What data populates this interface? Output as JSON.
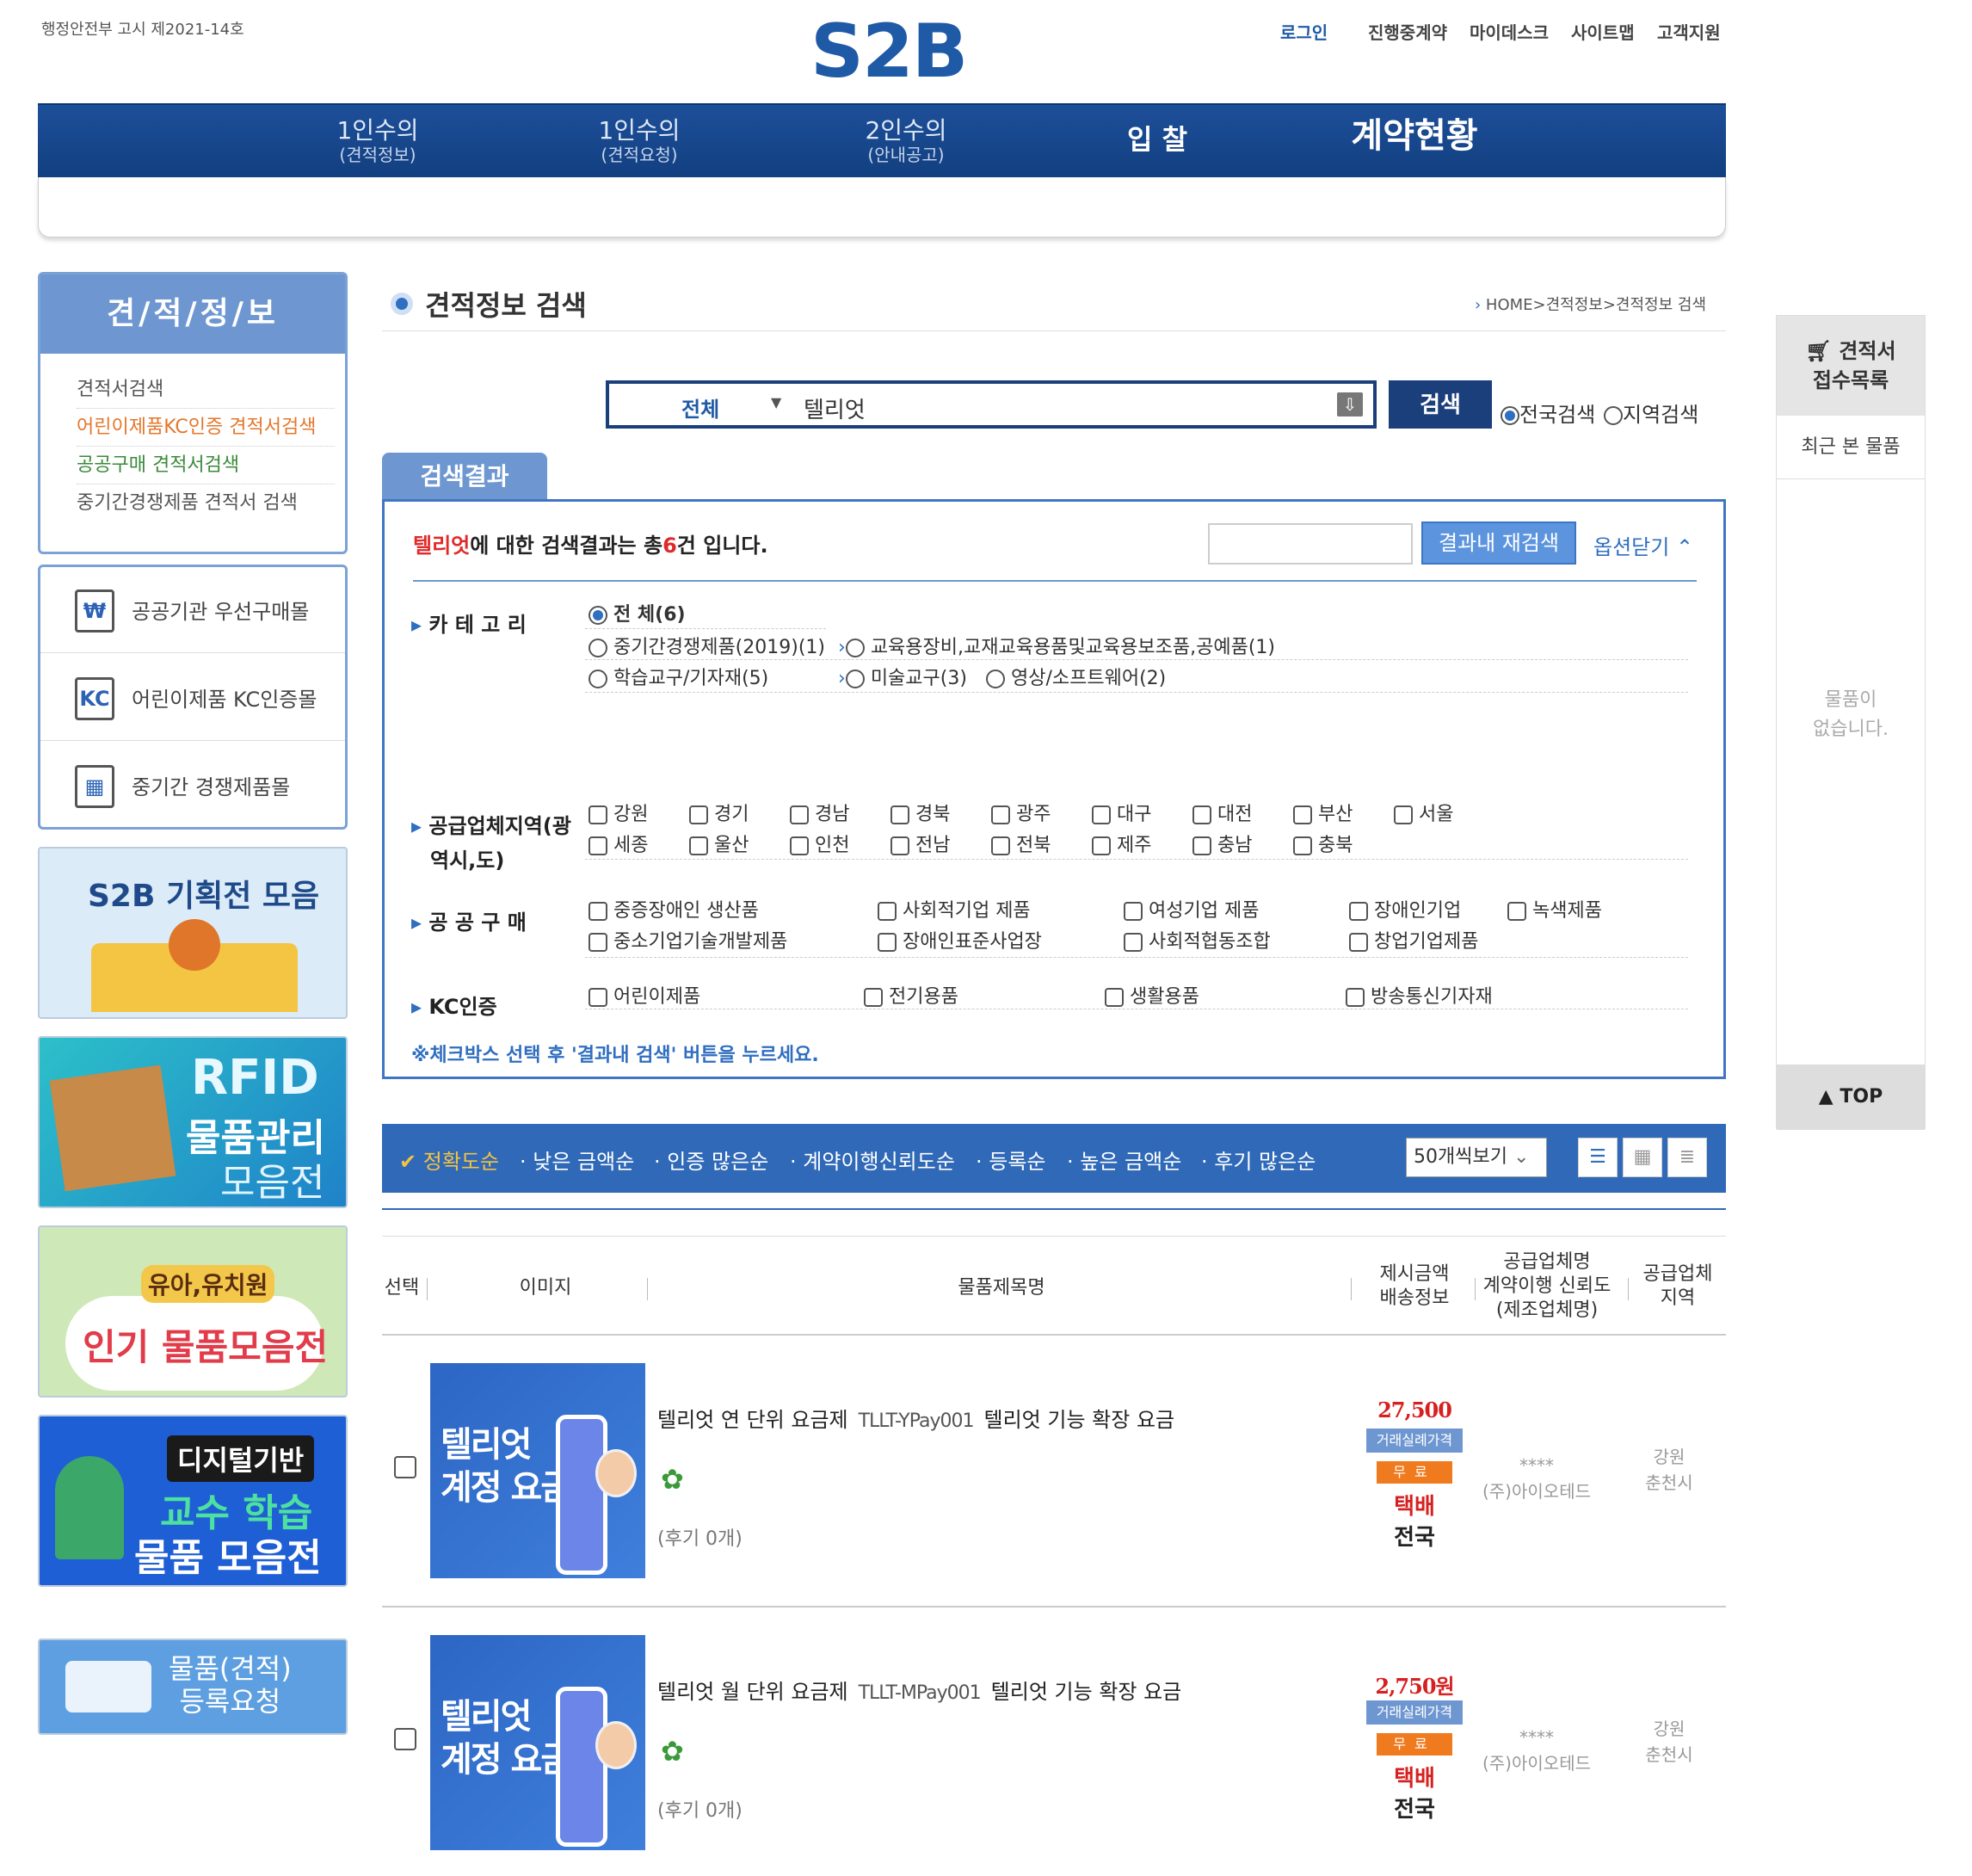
{
  "header": {
    "notice": "행정안전부 고시 제2021-14호",
    "logo": "S2B",
    "top_links": [
      "로그인",
      "진행중계약",
      "마이데스크",
      "사이트맵",
      "고객지원"
    ]
  },
  "gnb": [
    {
      "label": "1인수의",
      "sub": "(견적정보)"
    },
    {
      "label": "1인수의",
      "sub": "(견적요청)"
    },
    {
      "label": "2인수의",
      "sub": "(안내공고)"
    },
    {
      "label": "입 찰"
    },
    {
      "label": "계약현황"
    }
  ],
  "lnb": {
    "title": "견/적/정/보",
    "items": [
      "견적서검색",
      "어린이제품KC인증 견적서검색",
      "공공구매 견적서검색",
      "중기간경쟁제품 견적서 검색"
    ]
  },
  "quick_menu": [
    {
      "icon": "receipt-won-icon",
      "label": "공공기관 우선구매몰"
    },
    {
      "icon": "kc-mark-icon",
      "label": "어린이제품 KC인증몰"
    },
    {
      "icon": "building-icon",
      "label": "중기간 경쟁제품몰"
    }
  ],
  "banners": {
    "b1": "S2B 기획전 모음",
    "b2_line1": "RFID",
    "b2_line2": "물품관리",
    "b2_line3": "모음전",
    "b3_line1": "유아,유치원",
    "b3_line2": "인기 물품모음전",
    "b4_line1": "디지털기반",
    "b4_line2": "교수 학습",
    "b4_line3": "물품 모음전",
    "b5_line1": "물품(견적)",
    "b5_line2": "등록요청"
  },
  "page": {
    "title": "견적정보 검색",
    "breadcrumb": "HOME>견적정보>견적정보 검색"
  },
  "search": {
    "category": "전체",
    "query": "텔리엇",
    "button": "검색",
    "scope_national": "전국검색",
    "scope_region": "지역검색"
  },
  "results": {
    "tab": "검색결과",
    "keyword": "텔리엇",
    "summary_mid": "에 대한 검색결과는 ",
    "summary_total_pre": "총",
    "count": "6",
    "summary_tail": "건 입니다.",
    "refine_button": "결과내 재검색",
    "option_close": "옵션닫기"
  },
  "filters": {
    "category_label": "카 테 고 리",
    "categories": [
      "전 체(6)",
      "중기간경쟁제품(2019)(1)",
      "교육용장비,교재교육용품및교육용보조품,공예품(1)",
      "학습교구/기자재(5)",
      "미술교구(3)",
      "영상/소프트웨어(2)"
    ],
    "region_label_1": "공급업체지역(광",
    "region_label_2": "역시,도)",
    "regions": [
      "강원",
      "경기",
      "경남",
      "경북",
      "광주",
      "대구",
      "대전",
      "부산",
      "서울",
      "세종",
      "울산",
      "인천",
      "전남",
      "전북",
      "제주",
      "충남",
      "충북"
    ],
    "public_label": "공 공 구 매",
    "public": [
      "중증장애인 생산품",
      "사회적기업 제품",
      "여성기업 제품",
      "장애인기업",
      "녹색제품",
      "중소기업기술개발제품",
      "장애인표준사업장",
      "사회적협동조합",
      "창업기업제품"
    ],
    "kc_label": "KC인증",
    "kc": [
      "어린이제품",
      "전기용품",
      "생활용품",
      "방송통신기자재"
    ],
    "note": "※체크박스 선택 후 '결과내 검색' 버튼을 누르세요."
  },
  "sort": {
    "options": [
      "정확도순",
      "낮은 금액순",
      "인증 많은순",
      "계약이행신뢰도순",
      "등록순",
      "높은 금액순",
      "후기 많은순"
    ],
    "per_page": "50개씩보기"
  },
  "table": {
    "headers": [
      "선택",
      "이미지",
      "물품제목명",
      "제시금액",
      "배송정보",
      "공급업체명",
      "계약이행 신뢰도",
      "(제조업체명)",
      "공급업체",
      "지역"
    ],
    "rows": [
      {
        "thumb_line1": "텔리엇",
        "thumb_line2": "계정 요금제",
        "name": "텔리엇 연 단위 요금제",
        "model": "TLLT-YPay001",
        "desc": "텔리엇 기능 확장 요금",
        "review": "(후기 0개)",
        "price": "27,500원",
        "tag_price": "거래실례가격",
        "tag_ship": "무료",
        "ship": "택배",
        "ship_area": "전국",
        "rating": "****",
        "supplier": "(주)아이오테드",
        "region1": "강원",
        "region2": "춘천시"
      },
      {
        "thumb_line1": "텔리엇",
        "thumb_line2": "계정 요금제",
        "name": "텔리엇 월 단위 요금제",
        "model": "TLLT-MPay001",
        "desc": "텔리엇 기능 확장 요금",
        "review": "(후기 0개)",
        "price": "2,750원",
        "tag_price": "거래실례가격",
        "tag_ship": "무료",
        "ship": "택배",
        "ship_area": "전국",
        "rating": "****",
        "supplier": "(주)아이오테드",
        "region1": "강원",
        "region2": "춘천시"
      }
    ]
  },
  "right_quick": {
    "head_line1": "견적서",
    "head_line2": "접수목록",
    "recent": "최근 본 물품",
    "empty_line1": "물품이",
    "empty_line2": "없습니다.",
    "top": "TOP"
  }
}
